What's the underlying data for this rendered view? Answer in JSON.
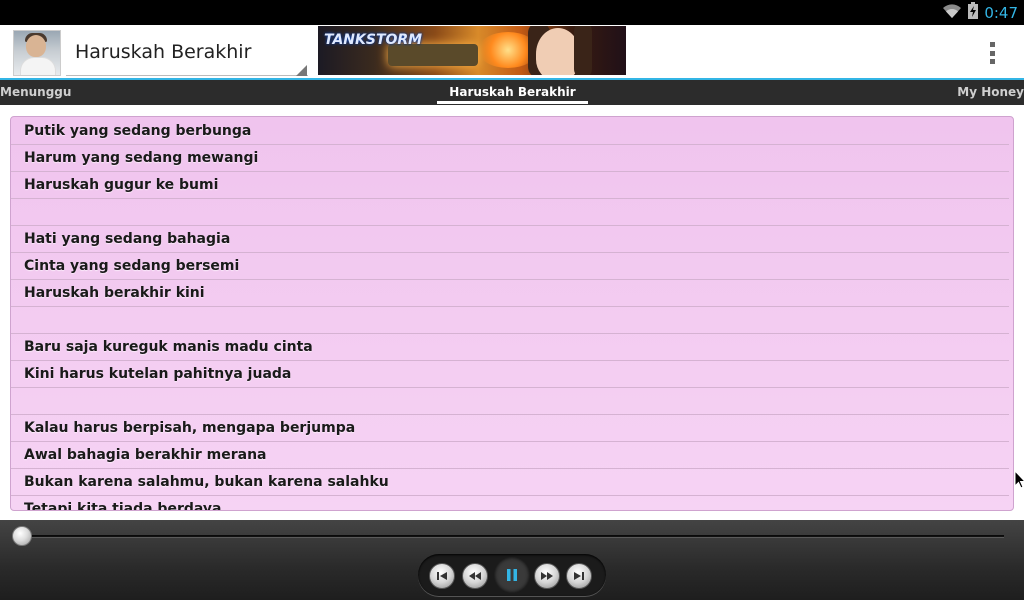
{
  "status_bar": {
    "time": "0:47",
    "icons": [
      "wifi-icon",
      "battery-charging-icon"
    ],
    "accent_color": "#33b5e5"
  },
  "action_bar": {
    "title": "Haruskah Berakhir",
    "avatar": "artist-avatar",
    "banner_ad": {
      "logo_text": "TANKSTORM"
    },
    "overflow_icon": "overflow-menu-icon"
  },
  "tabs": {
    "previous": "Menunggu",
    "current": "Haruskah Berakhir",
    "next": "My Honey"
  },
  "lyrics": [
    "Putik yang sedang berbunga",
    "Harum yang sedang mewangi",
    "Haruskah gugur ke bumi",
    "",
    "Hati yang sedang bahagia",
    "Cinta yang sedang bersemi",
    "Haruskah berakhir kini",
    "",
    "Baru saja kureguk manis madu cinta",
    "Kini harus kutelan pahitnya juada",
    "",
    "Kalau harus berpisah, mengapa berjumpa",
    "Awal bahagia berakhir merana",
    "Bukan karena salahmu, bukan karena salahku",
    "Tetapi kita tiada berdaya"
  ],
  "player": {
    "progress": 0.0,
    "controls": [
      "skip-previous-icon",
      "rewind-icon",
      "pause-icon",
      "fast-forward-icon",
      "skip-next-icon"
    ],
    "accent_color": "#33b5e5"
  }
}
